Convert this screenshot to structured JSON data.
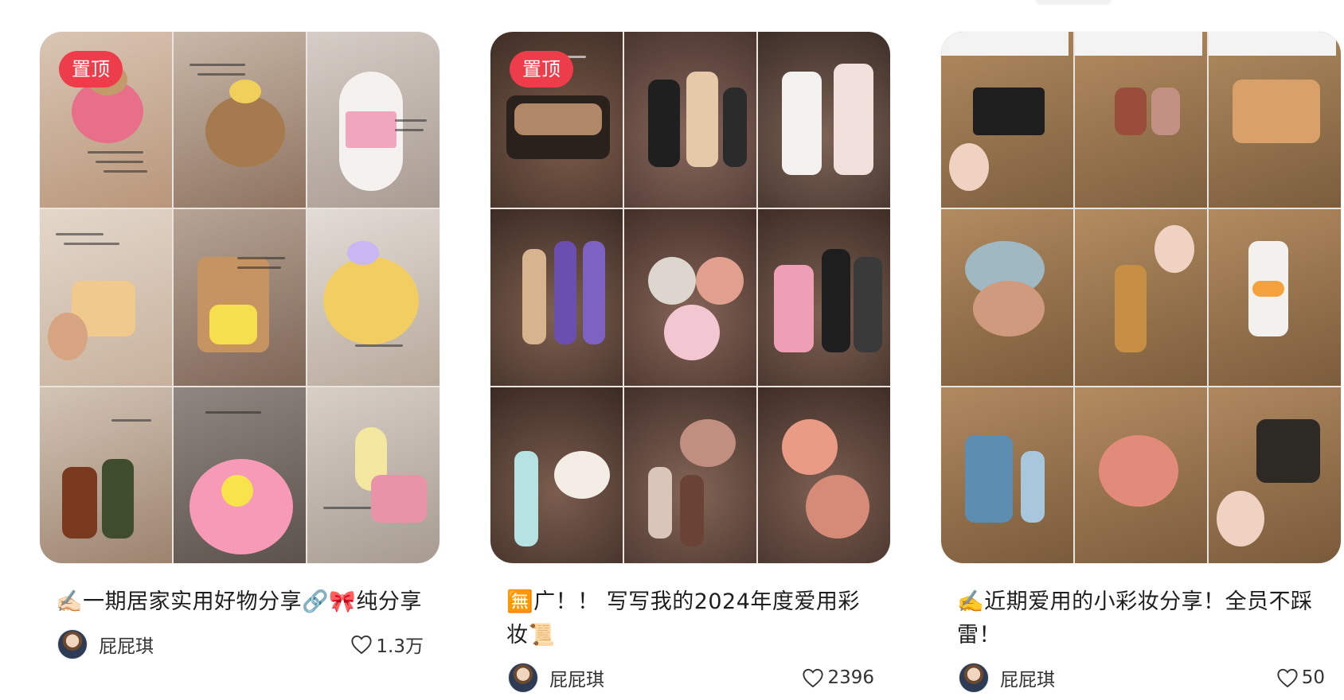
{
  "colors": {
    "pin_badge_bg": "#ee3d4a",
    "pin_badge_text": "#ffffff",
    "title_text": "#1e1e1e",
    "meta_text": "#333333"
  },
  "cards": [
    {
      "pinned_label": "置顶",
      "title": "✍🏻一期居家实用好物分享🔗🎀纯分享",
      "author": "屁屁琪",
      "likes": "1.3万",
      "icon": "heart-outline-icon"
    },
    {
      "pinned_label": "置顶",
      "title": "🈚广！！ 写写我的2024年度爱用彩妆📜",
      "author": "屁屁琪",
      "likes": "2396",
      "icon": "heart-outline-icon"
    },
    {
      "pinned_label": "",
      "title": "✍️近期爱用的小彩妆分享！全员不踩雷！",
      "author": "屁屁琪",
      "likes": "50",
      "icon": "heart-outline-icon"
    }
  ]
}
